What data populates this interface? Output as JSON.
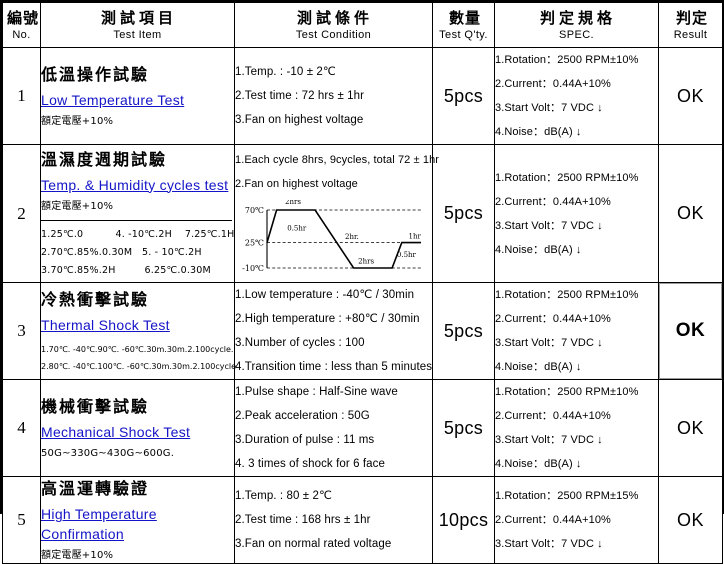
{
  "header": {
    "no": {
      "cn": "編號",
      "en": "No."
    },
    "test_item": {
      "cn": "測試項目",
      "en": "Test  Item"
    },
    "test_condition": {
      "cn": "測試條件",
      "en": "Test Condition"
    },
    "test_qty": {
      "cn": "數量",
      "en": "Test  Q'ty."
    },
    "spec": {
      "cn": "判定規格",
      "en": "SPEC."
    },
    "result": {
      "cn": "判定",
      "en": "Result"
    }
  },
  "colors": {
    "link": "#1414c8",
    "border": "#000000",
    "background": "#ffffff"
  },
  "rows": [
    {
      "no": "1",
      "item_cn": "低溫操作試驗",
      "item_en": "Low Temperature Test",
      "item_note": "額定電壓+10%",
      "item_sub": [],
      "conditions": [
        "1.Temp. : -10 ± 2℃",
        "2.Test time : 72 hrs ± 1hr",
        "3.Fan on highest voltage"
      ],
      "qty": "5pcs",
      "spec": [
        "1.Rotation：2500 RPM±10%",
        "2.Current：0.44A+10%",
        "3.Start Volt：7 VDC ↓",
        "4.Noise：dB(A) ↓"
      ],
      "result": "OK",
      "result_selected": false
    },
    {
      "no": "2",
      "item_cn": "溫濕度週期試驗",
      "item_en": "Temp. & Humidity cycles test",
      "item_note": "額定電壓+10%",
      "item_sub": [
        "1.25℃.0          4. -10℃.2H    7.25℃.1H",
        "2.70℃.85%.0.30M   5. - 10℃.2H",
        "3.70℃.85%.2H         6.25℃.0.30M"
      ],
      "conditions": [
        "1.Each cycle 8hrs, 9cycles, total 72 ± 1hr",
        "2.Fan on highest voltage"
      ],
      "qty": "5pcs",
      "spec": [
        "1.Rotation：2500 RPM±10%",
        "2.Current：0.44A+10%",
        "3.Start Volt：7 VDC ↓",
        "4.Noise：dB(A) ↓"
      ],
      "result": "OK",
      "result_selected": false
    },
    {
      "no": "3",
      "item_cn": "冷熱衝擊試驗",
      "item_en": "Thermal Shock Test",
      "item_note": "",
      "item_sub": [
        "1.70℃. -40℃.90℃. -60℃.30m.30m.2.100cycle.",
        "2.80℃. -40℃.100℃. -60℃.30m.30m.2.100cycle"
      ],
      "conditions": [
        "1.Low temperature : -40℃ / 30min",
        "2.High temperature : +80℃ / 30min",
        "3.Number of cycles : 100",
        "4.Transition time : less than 5 minutes"
      ],
      "qty": "5pcs",
      "spec": [
        "1.Rotation：2500 RPM±10%",
        "2.Current：0.44A+10%",
        "3.Start Volt：7 VDC ↓",
        "4.Noise：dB(A) ↓"
      ],
      "result": "OK",
      "result_selected": true
    },
    {
      "no": "4",
      "item_cn": "機械衝擊試驗",
      "item_en": "Mechanical Shock Test",
      "item_note": "50G~330G~430G~600G.",
      "item_sub": [],
      "conditions": [
        "1.Pulse shape : Half-Sine wave",
        "2.Peak acceleration : 50G",
        "3.Duration of pulse : 11 ms",
        "4. 3 times of shock for 6 face"
      ],
      "qty": "5pcs",
      "spec": [
        "1.Rotation：2500 RPM±10%",
        "2.Current：0.44A+10%",
        "3.Start Volt：7 VDC ↓",
        "4.Noise：dB(A) ↓"
      ],
      "result": "OK",
      "result_selected": false
    },
    {
      "no": "5",
      "item_cn": "高溫運轉驗證",
      "item_en": "High Temperature Confirmation",
      "item_note": "額定電壓+10%",
      "item_sub": [],
      "conditions": [
        "1.Temp. : 80 ± 2℃",
        "2.Test time : 168 hrs ± 1hr",
        "3.Fan on normal rated voltage"
      ],
      "qty": "10pcs",
      "spec": [
        "1.Rotation：2500 RPM±15%",
        "2.Current：0.44A+10%",
        "3.Start Volt：7 VDC ↓"
      ],
      "result": "OK",
      "result_selected": false
    }
  ],
  "chart_data": {
    "type": "line",
    "title": "",
    "xlabel": "",
    "ylabel": "",
    "grid": true,
    "legend": null,
    "y_ticks": [
      "70℃",
      "25℃",
      "-10℃"
    ],
    "y_values": [
      70,
      25,
      -10
    ],
    "ylim": [
      -10,
      70
    ],
    "segment_labels": [
      "0.5hr",
      "2hrs",
      "2hr.",
      "2hrs",
      "0.5hr",
      "1hr"
    ],
    "points": [
      {
        "t": 0,
        "temp": 25,
        "note": "start"
      },
      {
        "t": 0.5,
        "temp": 70,
        "note": "ramp up 0.5hr"
      },
      {
        "t": 2.5,
        "temp": 70,
        "note": "dwell 2hrs"
      },
      {
        "t": 4.5,
        "temp": -10,
        "note": "ramp down 2hr."
      },
      {
        "t": 6.5,
        "temp": -10,
        "note": "dwell 2hrs"
      },
      {
        "t": 7.0,
        "temp": 25,
        "note": "ramp up 0.5hr"
      },
      {
        "t": 8.0,
        "temp": 25,
        "note": "dwell 1hr"
      }
    ]
  }
}
